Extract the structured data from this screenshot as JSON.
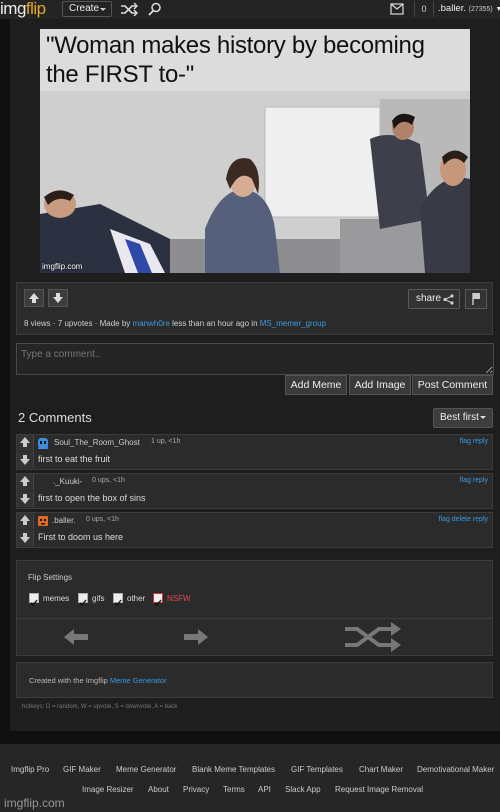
{
  "header": {
    "logo_left": "img",
    "logo_right": "flip",
    "create_label": "Create",
    "notif_count": "0",
    "username": ".baller.",
    "points": "(27355)",
    "icons": [
      "shuffle-icon",
      "search-icon",
      "mail-icon"
    ]
  },
  "meme": {
    "caption_line1": "\"Woman makes history by becoming",
    "caption_line2": "the FIRST to-\"",
    "watermark": "imgflip.com"
  },
  "post": {
    "share_label": "share",
    "views": "8 views",
    "upvotes": "7 upvotes",
    "made_by_prefix": "Made by",
    "author": "manwh0re",
    "time": "less than an hour ago in",
    "stream": "MS_memer_group"
  },
  "comment_box": {
    "placeholder": "Type a comment..",
    "add_meme": "Add Meme",
    "add_image": "Add Image",
    "post_comment": "Post Comment"
  },
  "comments": {
    "title": "2 Comments",
    "sort_label": "Best first",
    "items": [
      {
        "user": "Soul_The_Room_Ghost",
        "meta": "1 up, <1h",
        "actions": "flag reply",
        "text": "first to eat the fruit",
        "avatar_color": "#3c8ee0"
      },
      {
        "user": "._Kuuki-",
        "meta": "0 ups, <1h",
        "actions": "flag reply",
        "text": "first to open the box of sins",
        "avatar_color": ""
      },
      {
        "user": ".baller.",
        "meta": "0 ups, <1h",
        "actions": "flag delete reply",
        "text": "First to doom us here",
        "avatar_color": "#e06a1c"
      }
    ]
  },
  "flip_settings": {
    "title": "Flip Settings",
    "options": [
      "memes",
      "gifs",
      "other",
      "NSFW"
    ]
  },
  "created": {
    "prefix": "Created with the Imgflip",
    "link": "Meme Generator"
  },
  "hotkeys": "hotkeys: D = random, W = upvote, S = downvote, A = back",
  "footer": {
    "row1": [
      "Imgflip Pro",
      "GIF Maker",
      "Meme Generator",
      "Blank Meme Templates",
      "GIF Templates",
      "Chart Maker",
      "Demotivational Maker"
    ],
    "row2": [
      "Image Resizer",
      "About",
      "Privacy",
      "Terms",
      "API",
      "Slack App",
      "Request Image Removal"
    ],
    "logo": "imgflip.com"
  },
  "colors": {
    "link": "#3c9adf",
    "brand_orange": "#e2a530",
    "nsfw": "#e24b4b"
  }
}
